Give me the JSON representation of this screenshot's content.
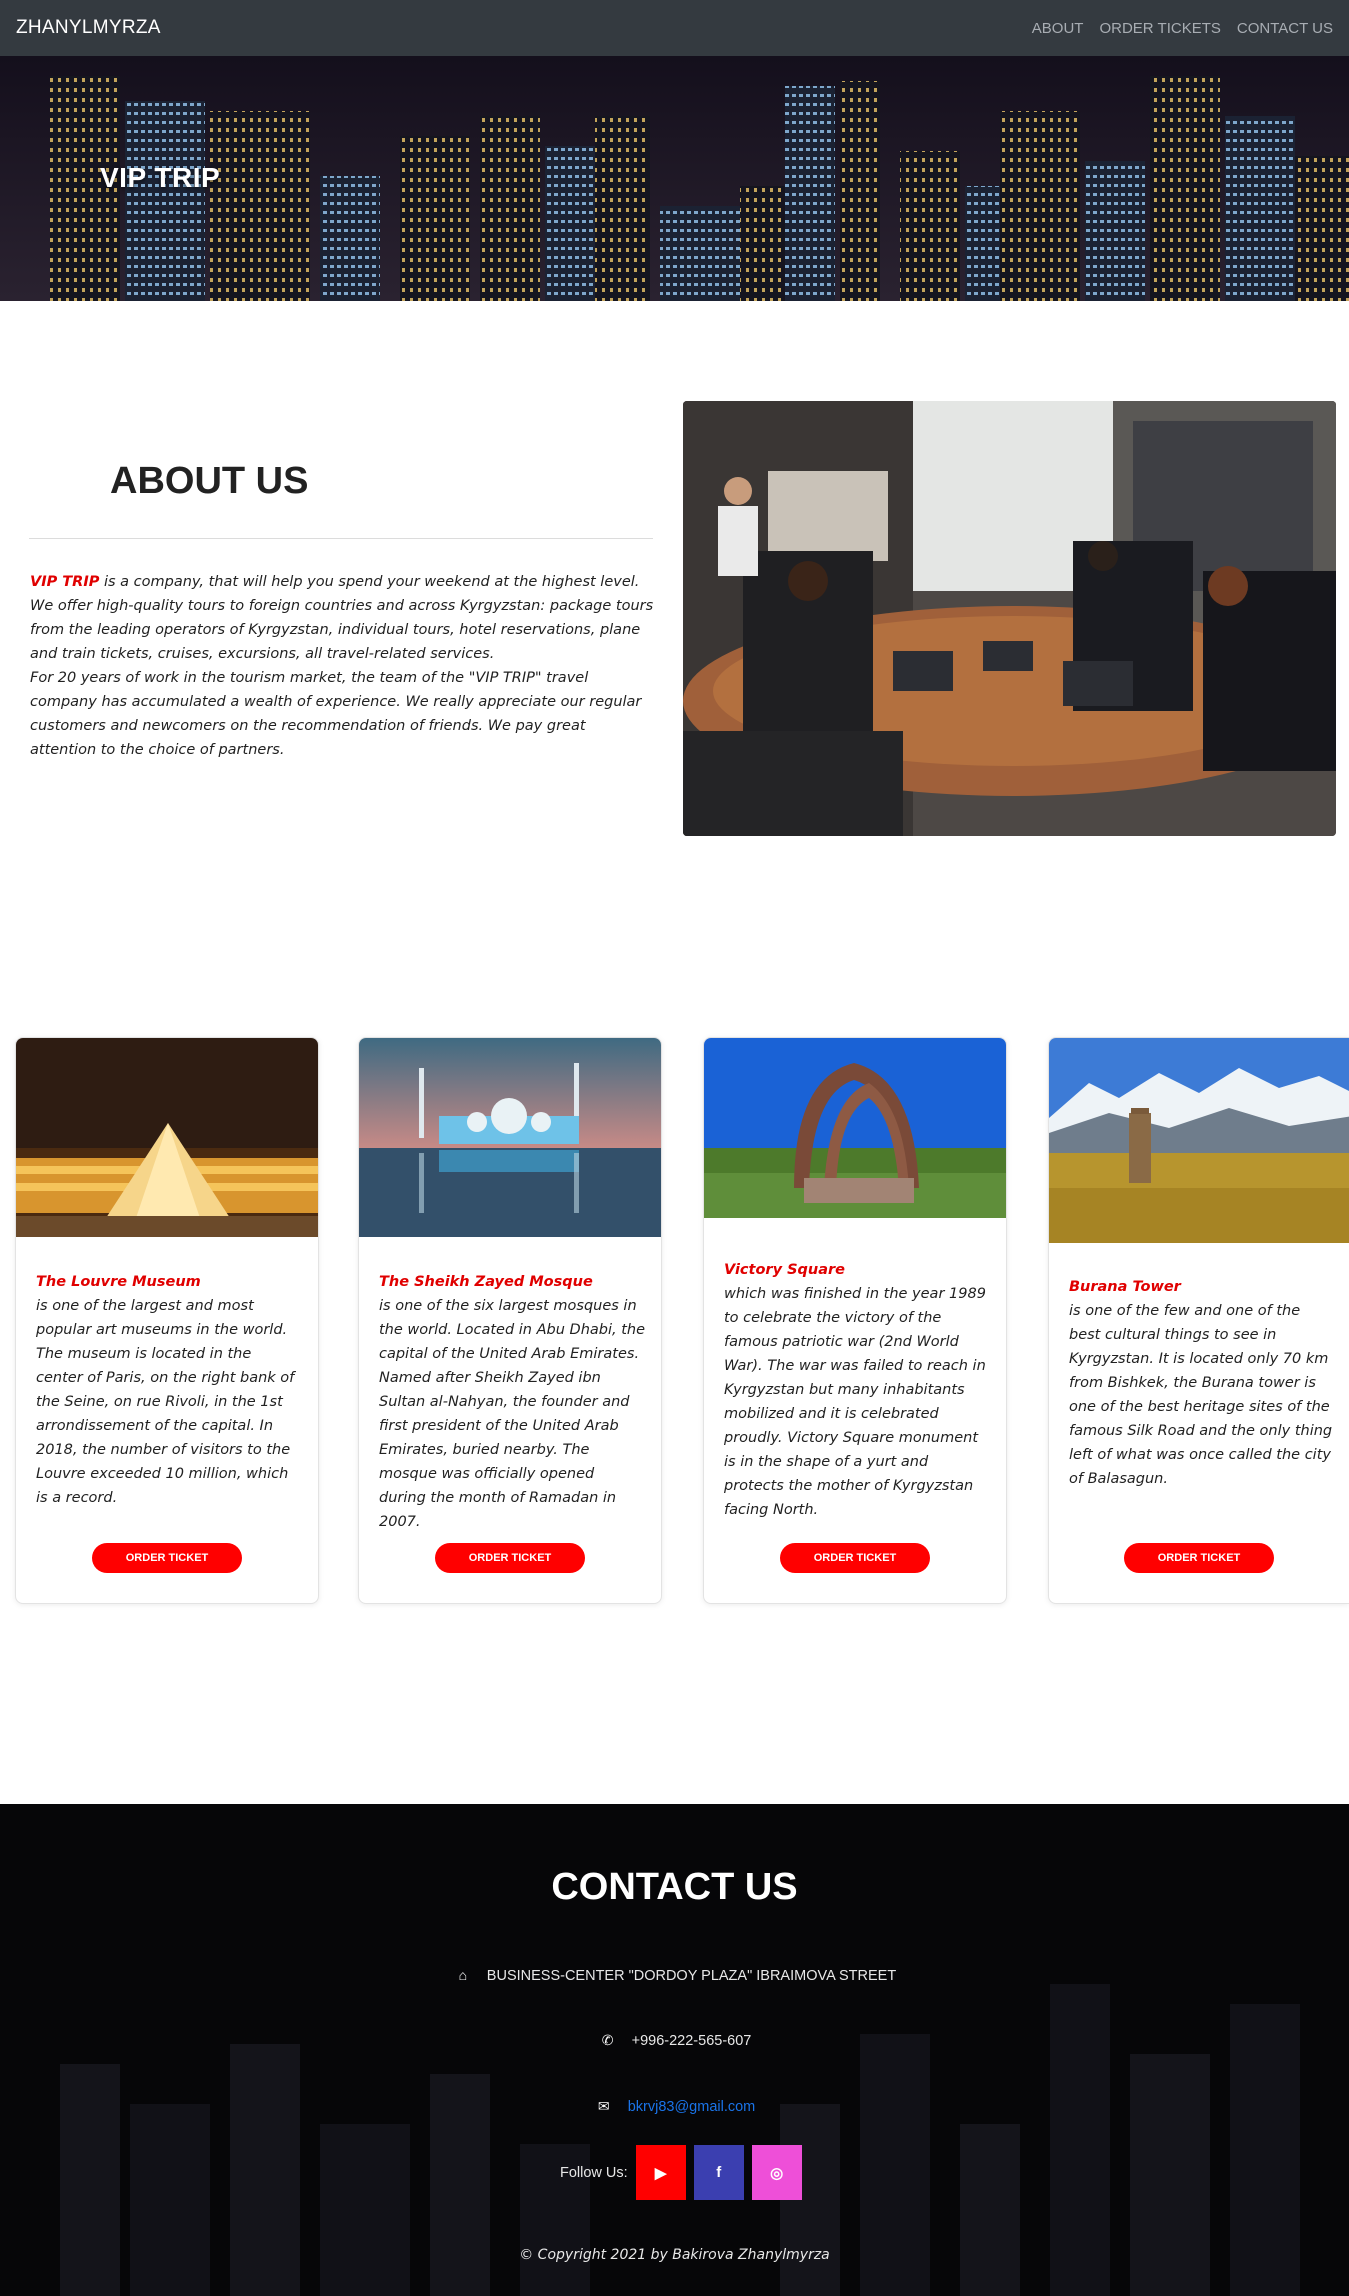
{
  "navbar": {
    "brand": "ZHANYLMYRZA",
    "links": [
      "ABOUT",
      "ORDER TICKETS",
      "CONTACT US"
    ]
  },
  "hero": {
    "title": "VIP TRIP"
  },
  "about": {
    "title": "ABOUT US",
    "highlight": "VIP TRIP",
    "text1": " is a company, that will help you spend your weekend at the highest level. We offer high-quality tours to foreign countries and across Kyrgyzstan: package tours from the leading operators of Kyrgyzstan, individual tours, hotel reservations, plane and train tickets, cruises, excursions, all travel-related services.",
    "text2": "For 20 years of work in the tourism market, the team of the \"VIP TRIP\" travel company has accumulated a wealth of experience. We really appreciate our regular customers and newcomers on the recommendation of friends. We pay great attention to the choice of partners."
  },
  "cards": [
    {
      "title": "The Louvre Museum",
      "text": "is one of the largest and most popular art museums in the world. The museum is located in the center of Paris, on the right bank of the Seine, on rue Rivoli, in the 1st arrondissement of the capital. In 2018, the number of visitors to the Louvre exceeded 10 million, which is a record.",
      "button": "ORDER TICKET"
    },
    {
      "title": "The Sheikh Zayed Mosque",
      "text": "is one of the six largest mosques in the world. Located in Abu Dhabi, the capital of the United Arab Emirates. Named after Sheikh Zayed ibn Sultan al-Nahyan, the founder and first president of the United Arab Emirates, buried nearby. The mosque was officially opened during the month of Ramadan in 2007.",
      "button": "ORDER TICKET"
    },
    {
      "title": "Victory Square",
      "text": "which was finished in the year 1989 to celebrate the victory of the famous patriotic war (2nd World War). The war was failed to reach in Kyrgyzstan but many inhabitants mobilized and it is celebrated proudly. Victory Square monument is in the shape of a yurt and protects the mother of Kyrgyzstan facing North.",
      "button": "ORDER TICKET"
    },
    {
      "title": "Burana Tower",
      "text": "is one of the few and one of the best cultural things to see in Kyrgyzstan. It is located only 70 km from Bishkek, the Burana tower is one of the best heritage sites of the famous Silk Road and the only thing left of what was once called the city of Balasagun.",
      "button": "ORDER TICKET"
    }
  ],
  "contact": {
    "title": "CONTACT US",
    "address": "BUSINESS-CENTER \"DORDOY PLAZA\" IBRAIMOVA STREET",
    "phone": "+996-222-565-607",
    "email": "bkrvj83@gmail.com",
    "follow_label": "Follow Us:",
    "socials": [
      {
        "name": "youtube",
        "glyph": "▶",
        "color": "#ff0000"
      },
      {
        "name": "facebook",
        "glyph": "f",
        "color": "#3b3fb0"
      },
      {
        "name": "instagram",
        "glyph": "◎",
        "color": "#ee4fd8"
      }
    ],
    "copyright": "© Copyright 2021 by Bakirova Zhanylmyrza"
  }
}
